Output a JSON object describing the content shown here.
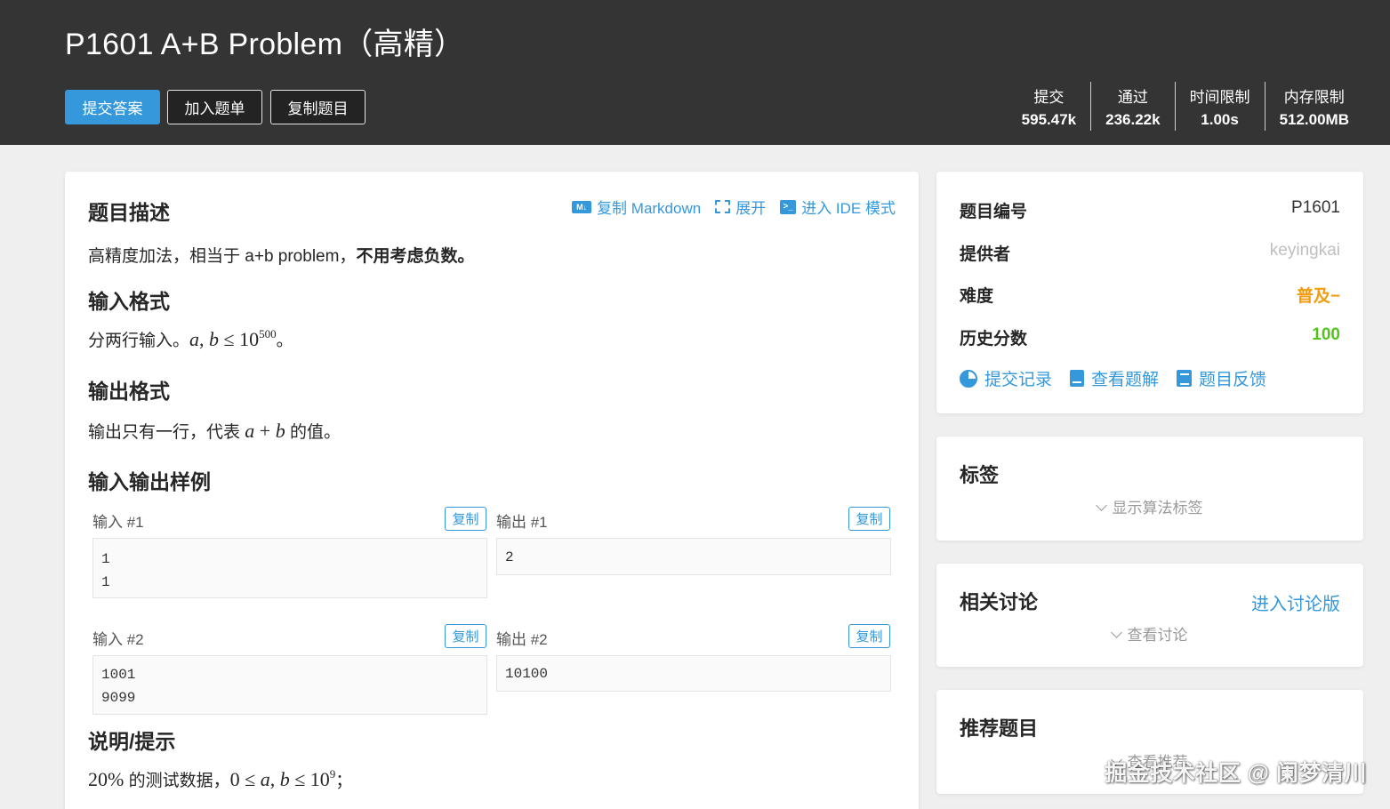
{
  "problem": {
    "title": "P1601 A+B Problem（高精）"
  },
  "actions": {
    "submit": "提交答案",
    "add_list": "加入题单",
    "copy": "复制题目"
  },
  "stats": [
    {
      "label": "提交",
      "value": "595.47k"
    },
    {
      "label": "通过",
      "value": "236.22k"
    },
    {
      "label": "时间限制",
      "value": "1.00s"
    },
    {
      "label": "内存限制",
      "value": "512.00MB"
    }
  ],
  "toolbar": {
    "markdown_icon": "M↓",
    "copy_md": "复制 Markdown",
    "expand": "展开",
    "ide_icon": ">_",
    "ide": "进入 IDE 模式"
  },
  "description": {
    "heading": "题目描述",
    "text": "高精度加法，相当于 a+b problem，",
    "bold": "不用考虑负数。",
    "end": ""
  },
  "input_format": {
    "heading": "输入格式",
    "prefix": "分两行输入。",
    "math_a": "a",
    "math_sep": ", ",
    "math_b": "b",
    "math_leq": " ≤ ",
    "math_base": "10",
    "math_exp": "500",
    "suffix": "。"
  },
  "output_format": {
    "heading": "输出格式",
    "prefix": "输出只有一行，代表 ",
    "math_a": "a",
    "math_plus": " + ",
    "math_b": "b",
    "suffix": " 的值。"
  },
  "samples": {
    "heading": "输入输出样例",
    "copy_label": "复制",
    "items": [
      {
        "in_label": "输入 #1",
        "out_label": "输出 #1",
        "in_lines": [
          "1",
          "1"
        ],
        "out_lines": [
          "2"
        ]
      },
      {
        "in_label": "输入 #2",
        "out_label": "输出 #2",
        "in_lines": [
          "1001",
          "9099"
        ],
        "out_lines": [
          "10100"
        ]
      }
    ]
  },
  "hint": {
    "heading": "说明/提示",
    "pct": "20%",
    "text": " 的测试数据，",
    "zero": "0",
    "leq1": " ≤ ",
    "a": "a",
    "sep": ", ",
    "b": "b",
    "leq2": " ≤ ",
    "base": "10",
    "exp": "9",
    "semi": "；"
  },
  "info": {
    "id_label": "题目编号",
    "id_value": "P1601",
    "provider_label": "提供者",
    "provider_value": "keyingkai",
    "difficulty_label": "难度",
    "difficulty_value": "普及−",
    "score_label": "历史分数",
    "score_value": "100",
    "links": {
      "records": "提交记录",
      "solutions": "查看题解",
      "feedback": "题目反馈"
    }
  },
  "tags": {
    "title": "标签",
    "toggle": "显示算法标签"
  },
  "discussion": {
    "title": "相关讨论",
    "link": "进入讨论版",
    "toggle": "查看讨论"
  },
  "recommend": {
    "title": "推荐题目",
    "toggle": "查看推荐"
  },
  "watermark": "掘金技术社区 @ 阑梦清川",
  "colors": {
    "header_bg": "#343434",
    "accent": "#3498db",
    "difficulty": "#f39c11",
    "score": "#52c41a",
    "provider": "#bfbfbf"
  }
}
